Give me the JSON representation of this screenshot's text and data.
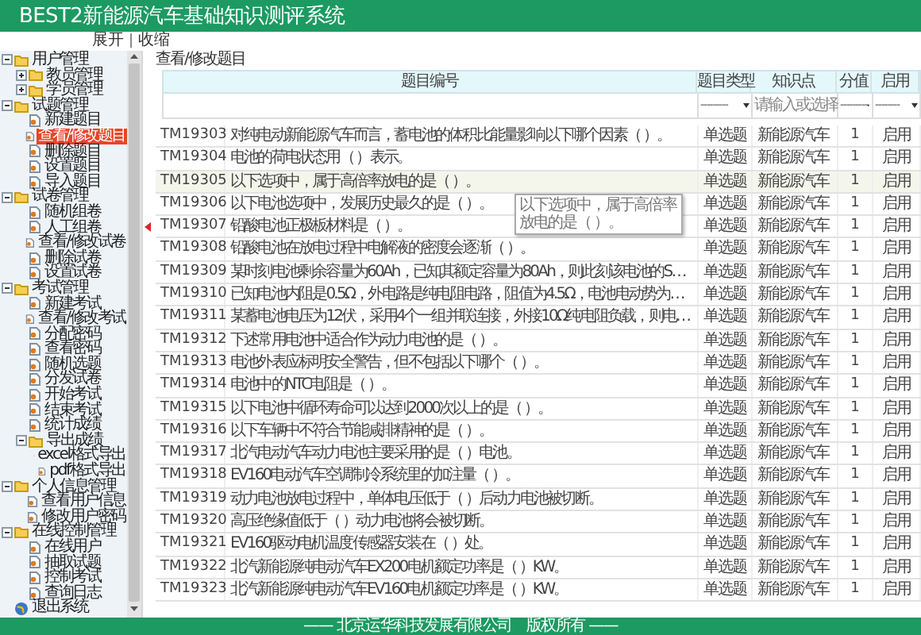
{
  "app_title": "BEST2新能源汽车基础知识测评系统",
  "tree_controls": [
    {
      "label": "展开"
    },
    {
      "label": "收缩"
    }
  ],
  "tree_controls_separator": "|",
  "sidebar": {
    "items": [
      {
        "kind": "folder",
        "label": "用户管理",
        "expanded": true,
        "children": [
          {
            "kind": "folder",
            "label": "教员管理",
            "expanded": false
          },
          {
            "kind": "folder",
            "label": "学员管理",
            "expanded": false
          }
        ]
      },
      {
        "kind": "folder",
        "label": "试题管理",
        "expanded": true,
        "children": [
          {
            "kind": "page",
            "label": "新建题目",
            "selected": false
          },
          {
            "kind": "page",
            "label": "查看/修改题目",
            "selected": true
          },
          {
            "kind": "page",
            "label": "删除题目",
            "selected": false
          },
          {
            "kind": "page",
            "label": "设置题目",
            "selected": false
          },
          {
            "kind": "page",
            "label": "导入题目",
            "selected": false
          }
        ]
      },
      {
        "kind": "folder",
        "label": "试卷管理",
        "expanded": true,
        "children": [
          {
            "kind": "page",
            "label": "随机组卷",
            "selected": false
          },
          {
            "kind": "page",
            "label": "人工组卷",
            "selected": false
          },
          {
            "kind": "page",
            "label": "查看/修改试卷",
            "selected": false
          },
          {
            "kind": "page",
            "label": "删除试卷",
            "selected": false
          },
          {
            "kind": "page",
            "label": "设置试卷",
            "selected": false
          }
        ]
      },
      {
        "kind": "folder",
        "label": "考试管理",
        "expanded": true,
        "children": [
          {
            "kind": "page",
            "label": "新建考试",
            "selected": false
          },
          {
            "kind": "page",
            "label": "查看/修改考试",
            "selected": false
          },
          {
            "kind": "page",
            "label": "分配密码",
            "selected": false
          },
          {
            "kind": "page",
            "label": "查看密码",
            "selected": false
          },
          {
            "kind": "page",
            "label": "随机选题",
            "selected": false
          },
          {
            "kind": "page",
            "label": "分发试卷",
            "selected": false
          },
          {
            "kind": "page",
            "label": "开始考试",
            "selected": false
          },
          {
            "kind": "page",
            "label": "结束考试",
            "selected": false
          },
          {
            "kind": "page",
            "label": "统计成绩",
            "selected": false
          },
          {
            "kind": "folder",
            "label": "导出成绩",
            "expanded": true,
            "children": [
              {
                "kind": "page",
                "label": "excel格式导出",
                "selected": false
              },
              {
                "kind": "page",
                "label": "pdf格式导出",
                "selected": false
              }
            ]
          }
        ]
      },
      {
        "kind": "folder",
        "label": "个人信息管理",
        "expanded": true,
        "children": [
          {
            "kind": "page",
            "label": "查看用户信息",
            "selected": false
          },
          {
            "kind": "page",
            "label": "修改用户密码",
            "selected": false
          }
        ]
      },
      {
        "kind": "folder",
        "label": "在线控制管理",
        "expanded": true,
        "children": [
          {
            "kind": "page",
            "label": "在线用户",
            "selected": false
          },
          {
            "kind": "page",
            "label": "抽取试题",
            "selected": false
          },
          {
            "kind": "page",
            "label": "控制考试",
            "selected": false
          },
          {
            "kind": "page",
            "label": "查询日志",
            "selected": false
          }
        ]
      },
      {
        "kind": "exit",
        "label": "退出系统",
        "selected": false
      }
    ]
  },
  "breadcrumb": "查看/修改题目",
  "table": {
    "columns": [
      "题目编号",
      "题目类型",
      "知识点",
      "分值",
      "启用"
    ],
    "filters": [
      {
        "value": "---------"
      },
      {
        "placeholder": "请输入或选择"
      },
      {
        "value": "---------"
      },
      {
        "value": "--------"
      }
    ],
    "rows": [
      {
        "id": "TM19303",
        "question": "对纯电动新能源汽车而言，蓄电池的体积比能量影响以下哪个因素（ ）。",
        "type": "单选题",
        "topic": "新能源汽车",
        "score": "1",
        "enabled": "启用",
        "selected": false
      },
      {
        "id": "TM19304",
        "question": "电池的荷电状态用（ ）表示。",
        "type": "单选题",
        "topic": "新能源汽车",
        "score": "1",
        "enabled": "启用",
        "selected": false
      },
      {
        "id": "TM19305",
        "question": "以下选项中，属于高倍率放电的是（ ）。",
        "type": "单选题",
        "topic": "新能源汽车",
        "score": "1",
        "enabled": "启用",
        "selected": true
      },
      {
        "id": "TM19306",
        "question": "以下电池选项中，发展历史最久的是（ ）。",
        "type": "单选题",
        "topic": "新能源汽车",
        "score": "1",
        "enabled": "启用",
        "selected": false
      },
      {
        "id": "TM19307",
        "question": "铅酸电池正极板材料是（ ）。",
        "type": "单选题",
        "topic": "新能源汽车",
        "score": "1",
        "enabled": "启用",
        "selected": false
      },
      {
        "id": "TM19308",
        "question": "铅酸电池在放电过程中电解液的密度会逐渐（ ）。",
        "type": "单选题",
        "topic": "新能源汽车",
        "score": "1",
        "enabled": "启用",
        "selected": false
      },
      {
        "id": "TM19309",
        "question": "某时刻电池剩余容量为60Ah，已知其额定容量为80Ah，则此刻该电池的S…",
        "type": "单选题",
        "topic": "新能源汽车",
        "score": "1",
        "enabled": "启用",
        "selected": false
      },
      {
        "id": "TM19310",
        "question": "已知电池内阻是0.5Ω，外电路是纯电阻电路，阻值为4.5Ω，电池电动势为…",
        "type": "单选题",
        "topic": "新能源汽车",
        "score": "1",
        "enabled": "启用",
        "selected": false
      },
      {
        "id": "TM19311",
        "question": "某蓄电池电压为12伏，采用4个一组并联连接，外接10Ω纯电阻负载，则电…",
        "type": "单选题",
        "topic": "新能源汽车",
        "score": "1",
        "enabled": "启用",
        "selected": false
      },
      {
        "id": "TM19312",
        "question": "下述常用电池中适合作为动力电池的是（ ）。",
        "type": "单选题",
        "topic": "新能源汽车",
        "score": "1",
        "enabled": "启用",
        "selected": false
      },
      {
        "id": "TM19313",
        "question": "电池外表应标明安全警告，但不包括以下哪个（ ）。",
        "type": "单选题",
        "topic": "新能源汽车",
        "score": "1",
        "enabled": "启用",
        "selected": false
      },
      {
        "id": "TM19314",
        "question": "电池中的NTC电阻是（ ）。",
        "type": "单选题",
        "topic": "新能源汽车",
        "score": "1",
        "enabled": "启用",
        "selected": false
      },
      {
        "id": "TM19315",
        "question": "以下电池中循环寿命可以达到2000次以上的是（ ）。",
        "type": "单选题",
        "topic": "新能源汽车",
        "score": "1",
        "enabled": "启用",
        "selected": false
      },
      {
        "id": "TM19316",
        "question": "以下车辆中不符合节能减排精神的是（ ）。",
        "type": "单选题",
        "topic": "新能源汽车",
        "score": "1",
        "enabled": "启用",
        "selected": false
      },
      {
        "id": "TM19317",
        "question": "北汽电动汽车动力电池主要采用的是（ ）电池。",
        "type": "单选题",
        "topic": "新能源汽车",
        "score": "1",
        "enabled": "启用",
        "selected": false
      },
      {
        "id": "TM19318",
        "question": "EV160电动汽车空调制冷系统里的加注量（ ）。",
        "type": "单选题",
        "topic": "新能源汽车",
        "score": "1",
        "enabled": "启用",
        "selected": false
      },
      {
        "id": "TM19319",
        "question": "动力电池放电过程中，单体电压低于（ ）后动力电池被切断。",
        "type": "单选题",
        "topic": "新能源汽车",
        "score": "1",
        "enabled": "启用",
        "selected": false
      },
      {
        "id": "TM19320",
        "question": "高压绝缘值低于（ ）动力电池将会被切断。",
        "type": "单选题",
        "topic": "新能源汽车",
        "score": "1",
        "enabled": "启用",
        "selected": false
      },
      {
        "id": "TM19321",
        "question": "EV160驱动电机温度传感器安装在（ ）处。",
        "type": "单选题",
        "topic": "新能源汽车",
        "score": "1",
        "enabled": "启用",
        "selected": false
      },
      {
        "id": "TM19322",
        "question": "北汽新能源纯电动汽车EX200电机额定功率是（ ）KW。",
        "type": "单选题",
        "topic": "新能源汽车",
        "score": "1",
        "enabled": "启用",
        "selected": false
      },
      {
        "id": "TM19323",
        "question": "北汽新能源纯电动汽车EV160电机额定功率是（ ）KW。",
        "type": "单选题",
        "topic": "新能源汽车",
        "score": "1",
        "enabled": "启用",
        "selected": false
      }
    ]
  },
  "tooltip": {
    "text": "以下选项中，属于高倍率放电的是（ ）。"
  },
  "footer": "—— 北京运华科技发展有限公司　版权所有 ——"
}
